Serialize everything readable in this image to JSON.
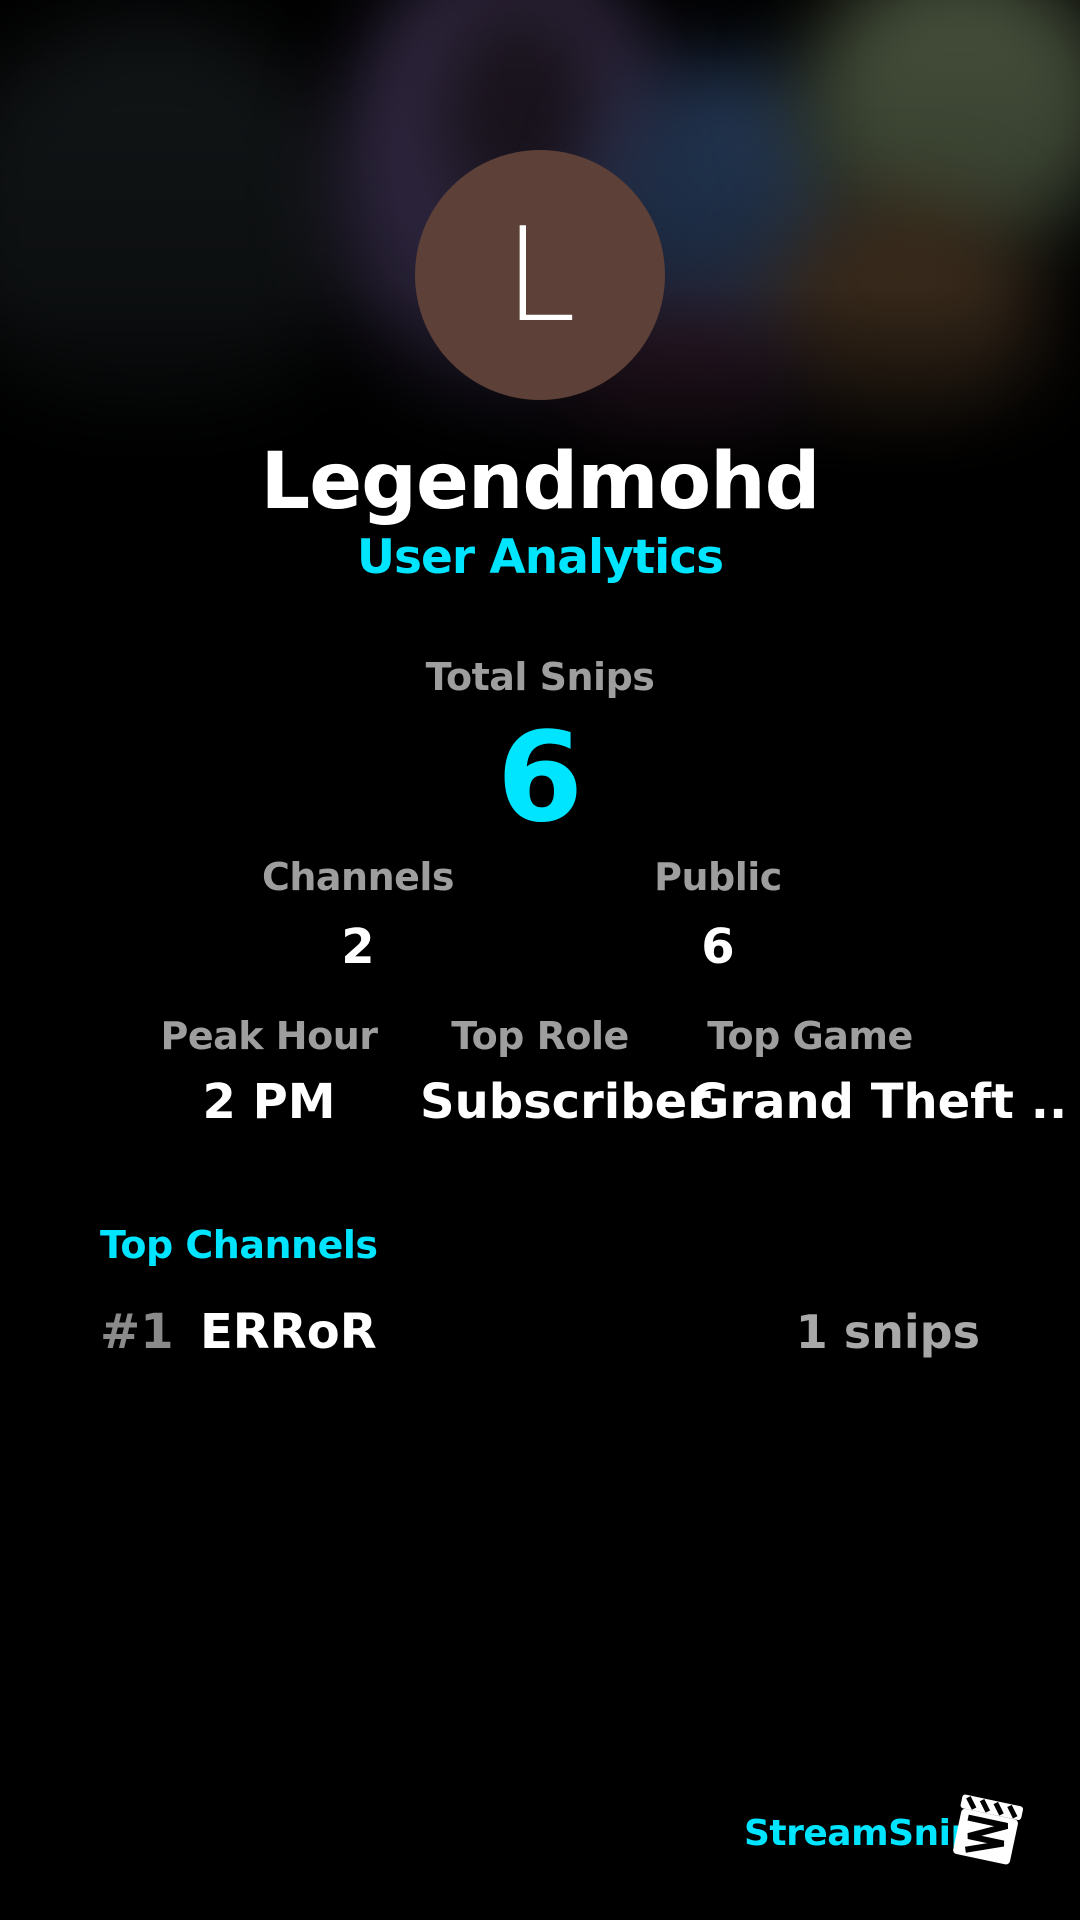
{
  "profile": {
    "avatar_initial": "L",
    "avatar_color": "#5d4037",
    "username": "Legendmohd",
    "subtitle": "User Analytics"
  },
  "stats": {
    "total_snips": {
      "label": "Total Snips",
      "value": "6"
    },
    "channels": {
      "label": "Channels",
      "value": "2"
    },
    "public": {
      "label": "Public",
      "value": "6"
    },
    "peak_hour": {
      "label": "Peak Hour",
      "value": "2 PM"
    },
    "top_role": {
      "label": "Top Role",
      "value": "Subscriber"
    },
    "top_game": {
      "label": "Top Game",
      "value": "Grand Theft .."
    }
  },
  "top_channels": {
    "title": "Top Channels",
    "items": [
      {
        "rank": "#1",
        "name": "ERRoR",
        "count": "1 snips"
      }
    ]
  },
  "brand": {
    "name": "StreamSnip",
    "logo_icon": "clapperboard-icon"
  },
  "colors": {
    "accent": "#00e5ff",
    "background": "#000000",
    "label": "#9e9e9e"
  }
}
